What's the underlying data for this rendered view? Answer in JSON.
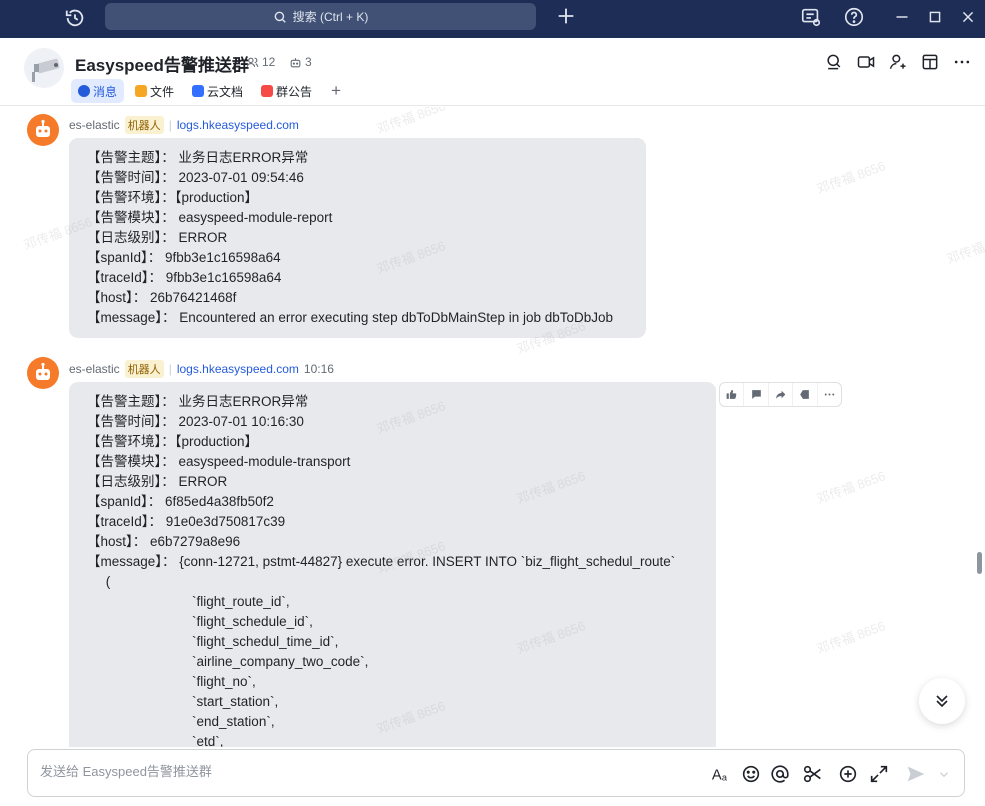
{
  "titlebar": {
    "search_placeholder": "搜索 (Ctrl + K)"
  },
  "chat": {
    "title": "Easyspeed告警推送群",
    "member_count": "12",
    "bot_count": "3",
    "tabs": [
      {
        "label": "消息",
        "icon": "message-icon",
        "color": "#245bdb",
        "active": true
      },
      {
        "label": "文件",
        "icon": "folder-icon",
        "color": "#f5a623",
        "active": false
      },
      {
        "label": "云文档",
        "icon": "doc-icon",
        "color": "#3370ff",
        "active": false
      },
      {
        "label": "群公告",
        "icon": "announcement-icon",
        "color": "#f54a45",
        "active": false
      }
    ]
  },
  "messages": [
    {
      "sender": "es-elastic",
      "badge": "机器人",
      "link": "logs.hkeasyspeed.com",
      "time": "",
      "lines": [
        "【告警主题】： 业务日志ERROR异常",
        "【告警时间】： 2023-07-01 09:54:46",
        "【告警环境】：【production】",
        "【告警模块】： easyspeed-module-report",
        "【日志级别】： ERROR",
        "【spanId】： 9fbb3e1c16598a64",
        "【traceId】： 9fbb3e1c16598a64",
        "【host】： 26b76421468f",
        "【message】： Encountered an error executing step dbToDbMainStep in job dbToDbJob"
      ]
    },
    {
      "sender": "es-elastic",
      "badge": "机器人",
      "link": "logs.hkeasyspeed.com",
      "time": "10:16",
      "lines": [
        "【告警主题】： 业务日志ERROR异常",
        "【告警时间】： 2023-07-01 10:16:30",
        "【告警环境】：【production】",
        "【告警模块】： easyspeed-module-transport",
        "【日志级别】： ERROR",
        "【spanId】： 6f85ed4a38fb50f2",
        "【traceId】： 91e0e3d750817c39",
        "【host】： e6b7279a8e96",
        "【message】： {conn-12721, pstmt-44827} execute error. INSERT INTO `biz_flight_schedul_route`",
        "     (",
        "                            `flight_route_id`,",
        "                            `flight_schedule_id`,",
        "                            `flight_schedul_time_id`,",
        "                            `airline_company_two_code`,",
        "                            `flight_no`,",
        "                            `start_station`,",
        "                            `end_station`,",
        "                            `etd`,"
      ]
    }
  ],
  "composer": {
    "placeholder": "发送给 Easyspeed告警推送群"
  },
  "watermark_text": "邓传福 8656"
}
